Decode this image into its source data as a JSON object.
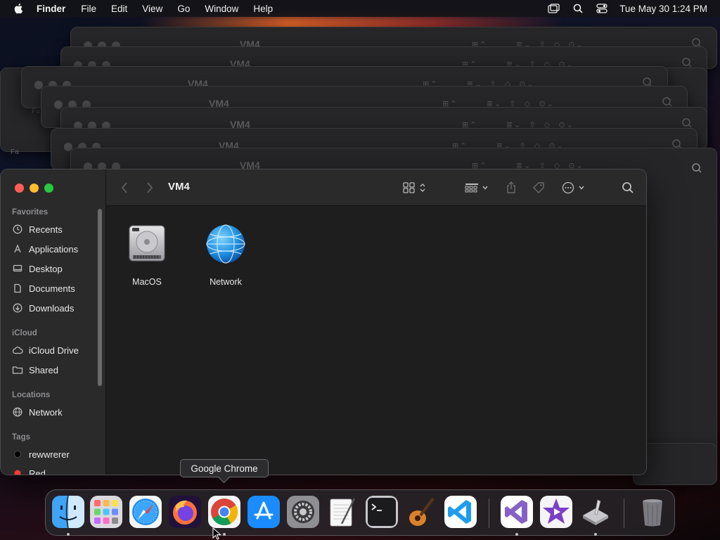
{
  "menubar": {
    "app_name": "Finder",
    "items": [
      "File",
      "Edit",
      "View",
      "Go",
      "Window",
      "Help"
    ],
    "clock": "Tue May 30  1:24 PM"
  },
  "background_windows": {
    "title": "VM4",
    "sidebar_fragments": [
      "Fa",
      "Fa"
    ]
  },
  "finder": {
    "title": "VM4",
    "sidebar": {
      "favorites_label": "Favorites",
      "favorites": [
        {
          "label": "Recents",
          "icon": "clock-icon"
        },
        {
          "label": "Applications",
          "icon": "applications-icon"
        },
        {
          "label": "Desktop",
          "icon": "desktop-icon"
        },
        {
          "label": "Documents",
          "icon": "document-icon"
        },
        {
          "label": "Downloads",
          "icon": "download-icon"
        }
      ],
      "icloud_label": "iCloud",
      "icloud": [
        {
          "label": "iCloud Drive",
          "icon": "cloud-icon"
        },
        {
          "label": "Shared",
          "icon": "shared-folder-icon"
        }
      ],
      "locations_label": "Locations",
      "locations": [
        {
          "label": "Network",
          "icon": "globe-icon"
        }
      ],
      "tags_label": "Tags",
      "tags": [
        {
          "label": "rewwrerer",
          "color": "#000000"
        },
        {
          "label": "Red",
          "color": "#ff3b30"
        }
      ]
    },
    "items": [
      {
        "label": "MacOS",
        "icon": "hard-drive-icon"
      },
      {
        "label": "Network",
        "icon": "network-globe-icon"
      }
    ]
  },
  "tooltip": {
    "text": "Google Chrome"
  },
  "dock": {
    "apps": [
      "Finder",
      "Launchpad",
      "Safari",
      "Firefox",
      "Google Chrome",
      "App Store",
      "System Preferences",
      "TextEdit",
      "Terminal",
      "GarageBand",
      "Visual Studio Code",
      "Visual Studio",
      "iMovie",
      "Xcode Tools",
      "Trash"
    ]
  },
  "colors": {
    "close": "#ff5f57",
    "minimize": "#febc2e",
    "maximize": "#28c840",
    "sidebar_bg": "#2a2a2b",
    "content_bg": "#1e1e1e"
  }
}
